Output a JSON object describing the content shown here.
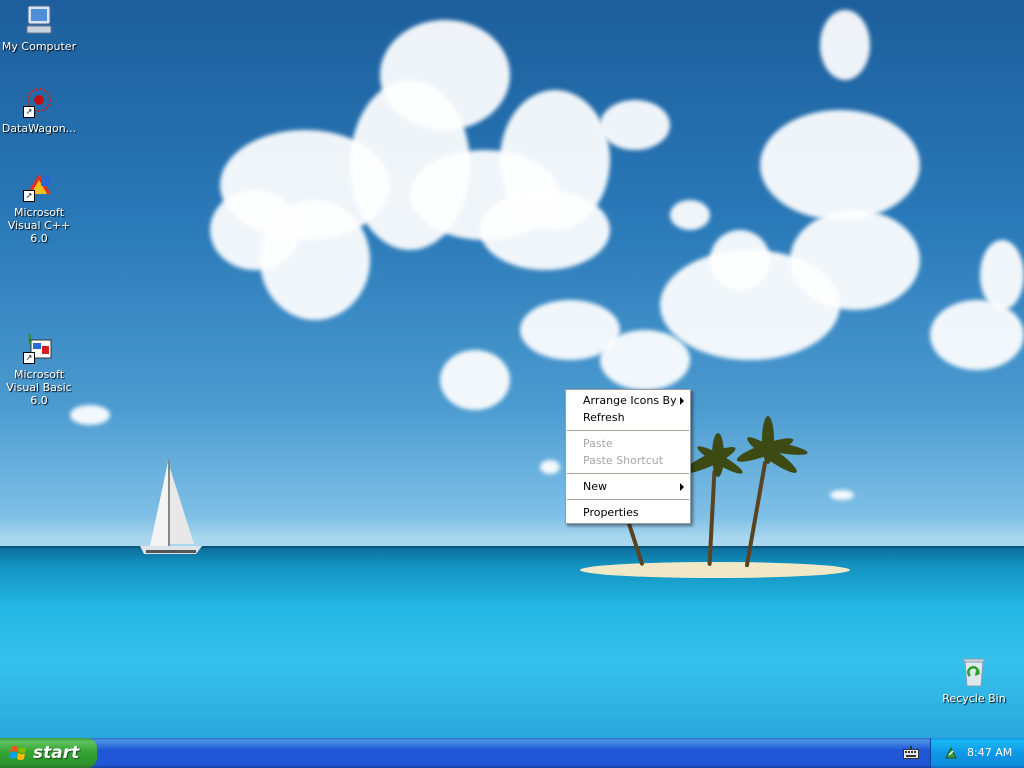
{
  "desktop": {
    "icons": [
      {
        "label": "My Computer"
      },
      {
        "label": "DataWagon..."
      },
      {
        "label": "Microsoft Visual C++ 6.0"
      },
      {
        "label": "Microsoft Visual Basic 6.0"
      },
      {
        "label": "Recycle Bin"
      }
    ]
  },
  "context_menu": {
    "items": [
      {
        "label": "Arrange Icons By",
        "submenu": true,
        "enabled": true
      },
      {
        "label": "Refresh",
        "enabled": true
      },
      {
        "label": "Paste",
        "enabled": false
      },
      {
        "label": "Paste Shortcut",
        "enabled": false
      },
      {
        "label": "New",
        "submenu": true,
        "enabled": true
      },
      {
        "label": "Properties",
        "enabled": true
      }
    ]
  },
  "taskbar": {
    "start_label": "start",
    "clock": "8:47 AM"
  },
  "colors": {
    "taskbar_blue": "#2157d7",
    "start_green": "#35a535",
    "tray_blue": "#0f97e7"
  }
}
